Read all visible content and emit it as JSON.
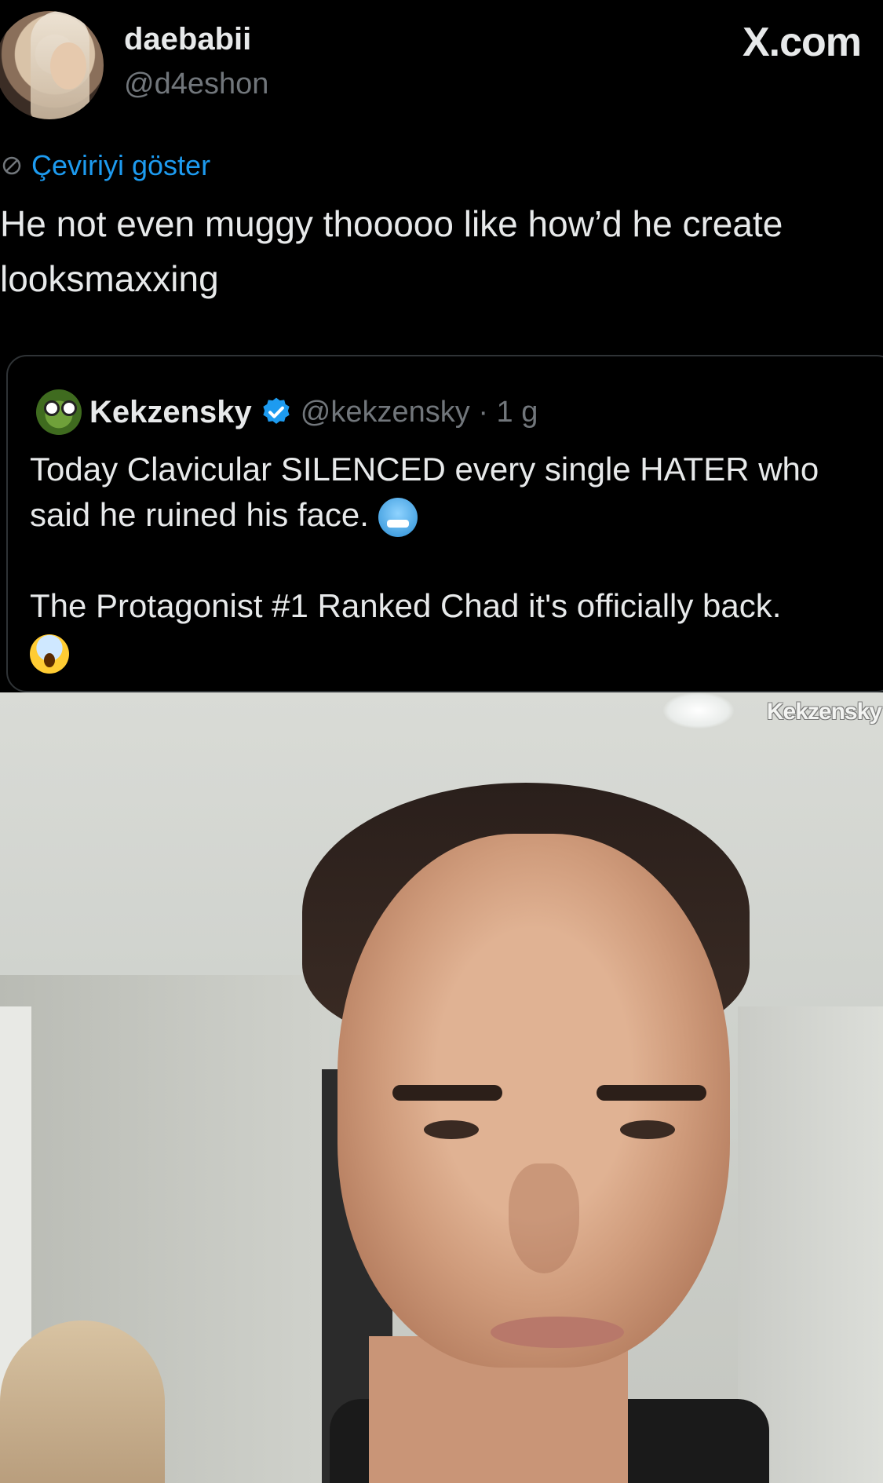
{
  "header": {
    "display_name": "daebabii",
    "handle": "@d4eshon",
    "site": "X.com"
  },
  "translate_label": "Çeviriyi göster",
  "tweet_text": "He not even muggy thooooo like how’d he create looksmaxxing",
  "quote": {
    "name": "Kekzensky",
    "meta": "@kekzensky · 1 g",
    "line1": "Today Clavicular SILENCED every single HATER who said he ruined his face.",
    "line2": "The Protagonist #1 Ranked Chad it's officially back.",
    "emoji1": "cold-face-emoji",
    "emoji2": "screaming-face-emoji"
  },
  "photo": {
    "watermark": "Kekzensky"
  },
  "colors": {
    "background": "#000000",
    "text": "#e7e9ea",
    "muted": "#71767b",
    "link": "#1d9bf0",
    "border": "#2f3336"
  }
}
